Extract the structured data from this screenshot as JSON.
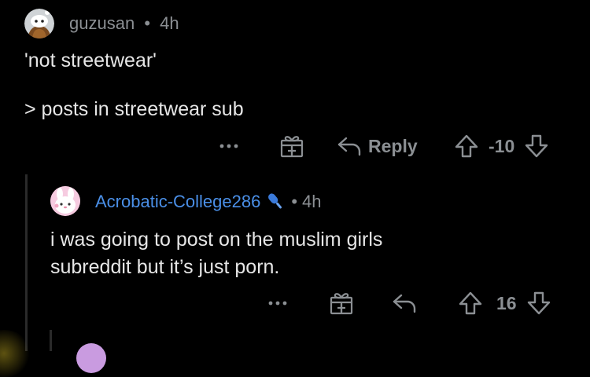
{
  "comments": [
    {
      "username": "guzusan",
      "separator": "•",
      "time": "4h",
      "lines": [
        "'not streetwear'",
        "> posts in streetwear sub"
      ],
      "actions": {
        "reply_label": "Reply",
        "score": "-10"
      },
      "avatar_icon": "reddit-snoo-avatar-icon"
    },
    {
      "username": "Acrobatic-College286",
      "separator": "•",
      "time": "4h",
      "lines": [
        "i was going to post on the muslim girls",
        "subreddit but it’s just porn."
      ],
      "actions": {
        "score": "16"
      },
      "avatar_icon": "pink-bunny-avatar-icon",
      "flair_icon": "mic-icon"
    }
  ],
  "colors": {
    "background": "#000000",
    "meta_text": "#8b8f93",
    "body_text": "#e6e6e6",
    "op_username": "#4a8fe7",
    "thread_line": "#2a2a2a"
  },
  "icons": [
    "more-dots-icon",
    "award-gift-icon",
    "reply-arrow-icon",
    "upvote-icon",
    "downvote-icon"
  ]
}
